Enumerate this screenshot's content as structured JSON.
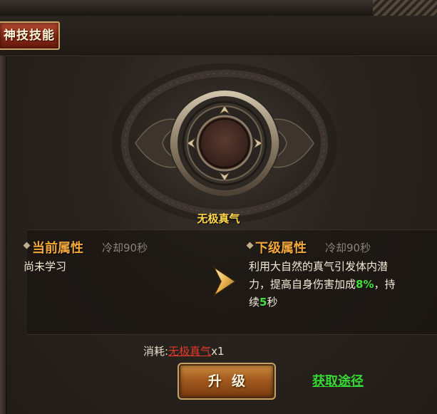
{
  "header": {
    "tab_label": "神技技能"
  },
  "skill": {
    "name": "无极真气"
  },
  "current": {
    "title": "当前属性",
    "cooldown": "冷却90秒",
    "text": "尚未学习"
  },
  "next": {
    "title": "下级属性",
    "cooldown": "冷却90秒",
    "line1": "利用大自然的真气引发体内潜",
    "line2_prefix": "力，提高自身伤害加成",
    "line2_value": "8%",
    "line2_suffix": "，持",
    "line3_prefix": "续",
    "line3_value": "5",
    "line3_suffix": "秒"
  },
  "cost": {
    "label": "消耗:",
    "item": "无极真气",
    "quantity": "x1"
  },
  "actions": {
    "upgrade_label": "升级",
    "obtain_label": "获取途径"
  },
  "colors": {
    "accent_gold": "#f1a73a",
    "highlight_green": "#3fe03b",
    "cost_red": "#e23a2e",
    "tab_red": "#7f2413"
  }
}
